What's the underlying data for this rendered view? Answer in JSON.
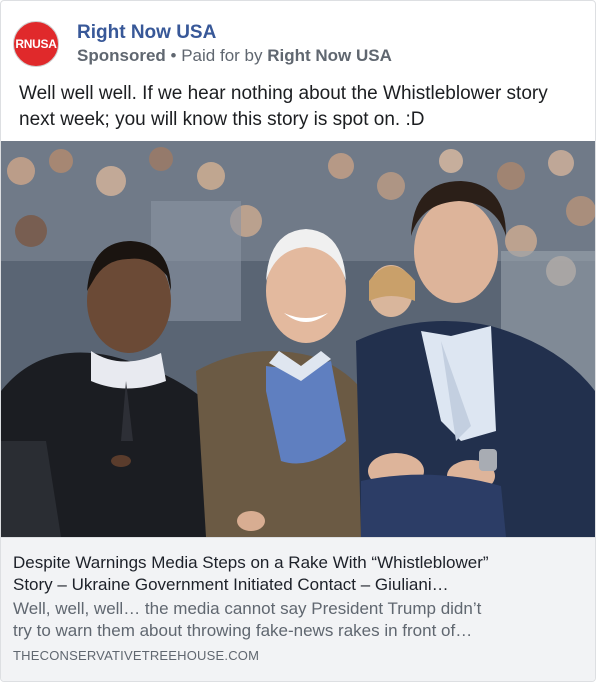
{
  "ad": {
    "avatar_text": "RNUSA",
    "page_name": "Right Now USA",
    "sponsored_label": "Sponsored",
    "separator": "•",
    "paid_for_label": "Paid for by",
    "payer_name": "Right Now USA",
    "post_text": "Well well well. If we hear nothing about the Whistleblower story next week; you will know this story is spot on. :D"
  },
  "link_preview": {
    "title_line1": "Despite Warnings Media Steps on a Rake With “Whistleblower”",
    "title_line2": "Story – Ukraine Government Initiated Contact – Giuliani…",
    "desc_line1": "Well, well, well… the media cannot say President Trump didn’t",
    "desc_line2": "try to warn them about throwing fake-news rakes in front of…",
    "domain": "THECONSERVATIVETREEHOUSE.COM"
  },
  "colors": {
    "brand_red": "#e0292b",
    "link_blue": "#385898",
    "meta_gray": "#606770",
    "preview_bg": "#f2f3f5"
  }
}
